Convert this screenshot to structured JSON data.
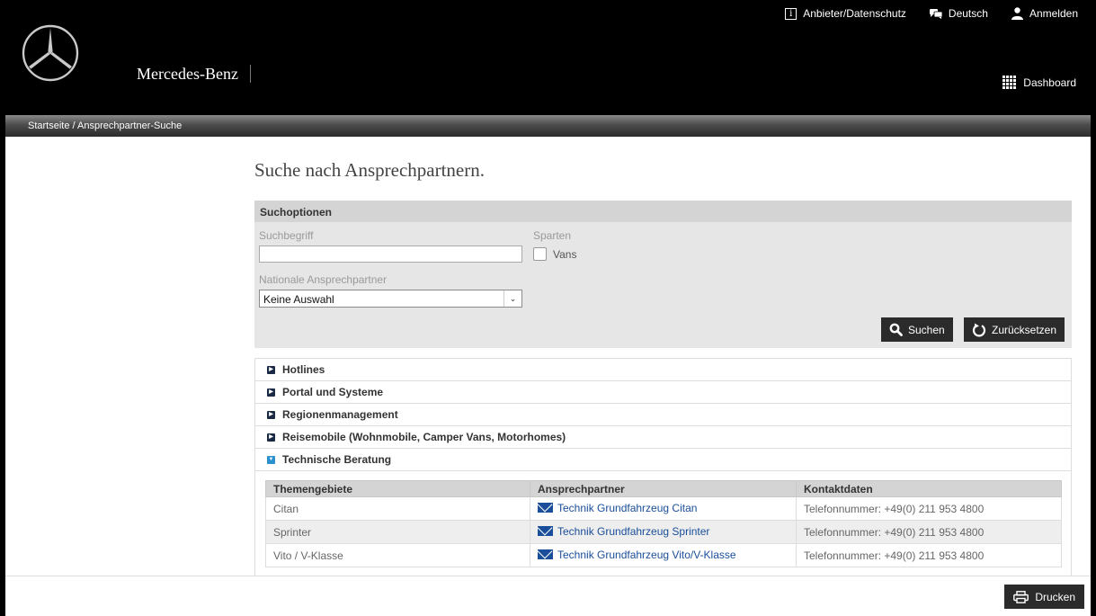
{
  "header": {
    "brand": "Mercedes-Benz",
    "nav": {
      "imprint": "Anbieter/Datenschutz",
      "language": "Deutsch",
      "login": "Anmelden"
    },
    "dashboard": "Dashboard"
  },
  "breadcrumb": {
    "home": "Startseite",
    "separator": " / ",
    "current": "Ansprechpartner-Suche"
  },
  "page": {
    "title": "Suche nach Ansprechpartnern."
  },
  "search": {
    "panel_title": "Suchoptionen",
    "term_label": "Suchbegriff",
    "term_value": "",
    "divisions_label": "Sparten",
    "vans_label": "Vans",
    "vans_checked": false,
    "national_label": "Nationale Ansprechpartner",
    "national_selected": "Keine Auswahl",
    "search_button": "Suchen",
    "reset_button": "Zurücksetzen"
  },
  "accordion": {
    "items": [
      {
        "label": "Hotlines",
        "expanded": false
      },
      {
        "label": "Portal und Systeme",
        "expanded": false
      },
      {
        "label": "Regionenmanagement",
        "expanded": false
      },
      {
        "label": "Reisemobile (Wohnmobile, Camper Vans, Motorhomes)",
        "expanded": false
      },
      {
        "label": "Technische Beratung",
        "expanded": true
      }
    ]
  },
  "table": {
    "headers": [
      "Themengebiete",
      "Ansprechpartner",
      "Kontaktdaten"
    ],
    "rows": [
      {
        "topic": "Citan",
        "contact": "Technik Grundfahrzeug Citan",
        "phone": "Telefonnummer: +49(0) 211 953 4800"
      },
      {
        "topic": "Sprinter",
        "contact": "Technik Grundfahrzeug Sprinter",
        "phone": "Telefonnummer: +49(0) 211 953 4800"
      },
      {
        "topic": "Vito / V-Klasse",
        "contact": "Technik Grundfahrzeug Vito/V-Klasse",
        "phone": "Telefonnummer: +49(0) 211 953 4800"
      }
    ]
  },
  "footer": {
    "print_button": "Drucken"
  },
  "colors": {
    "header_bg": "#000000",
    "button_bg": "#2b2b2b",
    "link": "#1a4e9a",
    "accordion_open_icon": "#2a90d0"
  },
  "icons": [
    "mercedes-star-logo",
    "info-icon",
    "chat-icon",
    "user-icon",
    "grid-icon",
    "search-icon",
    "reset-icon",
    "expand-icon",
    "collapse-icon",
    "mail-icon",
    "printer-icon",
    "chevron-down-icon"
  ]
}
